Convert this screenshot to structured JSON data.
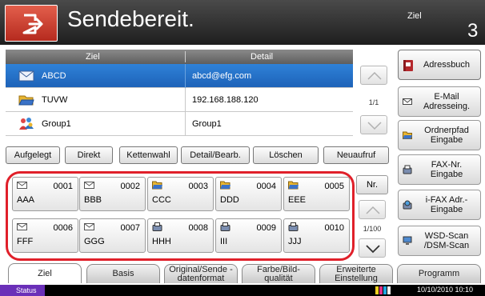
{
  "header": {
    "title": "Sendebereit.",
    "ziel_label": "Ziel",
    "ziel_count": "3",
    "send_icon": "send-to-icon"
  },
  "dest_table": {
    "col_ziel": "Ziel",
    "col_detail": "Detail",
    "rows": [
      {
        "name": "ABCD",
        "detail": "abcd@efg.com",
        "icon": "email-icon",
        "selected": true
      },
      {
        "name": "TUVW",
        "detail": "192.168.188.120",
        "icon": "folder-icon",
        "selected": false
      },
      {
        "name": "Group1",
        "detail": "Group1",
        "icon": "group-icon",
        "selected": false
      }
    ],
    "page": "1/1"
  },
  "side_buttons": {
    "adressbuch": "Adressbuch",
    "email": "E-Mail Adresseing.",
    "ordner": "Ordnerpfad Eingabe",
    "fax": "FAX-Nr. Eingabe",
    "ifax": "i-FAX Adr.-Eingabe",
    "wsd": "WSD-Scan /DSM-Scan"
  },
  "tools": {
    "aufgelegt": "Aufgelegt",
    "direkt": "Direkt",
    "kettenwahl": "Kettenwahl",
    "detail": "Detail/Bearb.",
    "loeschen": "Löschen",
    "neuaufruf": "Neuaufruf"
  },
  "one_touch": {
    "nr_label": "Nr.",
    "page": "1/100",
    "keys": [
      {
        "num": "0001",
        "name": "AAA",
        "icon": "email-icon"
      },
      {
        "num": "0002",
        "name": "BBB",
        "icon": "email-icon"
      },
      {
        "num": "0003",
        "name": "CCC",
        "icon": "folder-icon"
      },
      {
        "num": "0004",
        "name": "DDD",
        "icon": "folder-icon"
      },
      {
        "num": "0005",
        "name": "EEE",
        "icon": "folder-icon"
      },
      {
        "num": "0006",
        "name": "FFF",
        "icon": "email-icon"
      },
      {
        "num": "0007",
        "name": "GGG",
        "icon": "email-icon"
      },
      {
        "num": "0008",
        "name": "HHH",
        "icon": "fax-icon"
      },
      {
        "num": "0009",
        "name": "III",
        "icon": "fax-icon"
      },
      {
        "num": "0010",
        "name": "JJJ",
        "icon": "fax-icon"
      }
    ]
  },
  "tabs": {
    "ziel": "Ziel",
    "basis": "Basis",
    "original": "Original/Sende -datenformat",
    "farbe": "Farbe/Bild- qualität",
    "erweiterte": "Erweiterte Einstellung",
    "programm": "Programm"
  },
  "status": {
    "label": "Status",
    "datetime": "10/10/2010  10:10"
  },
  "colors": {
    "header_bg": "#2b2b2b",
    "send_tile": "#c93a2c",
    "selected_row": "#2371c8",
    "one_touch_outline": "#e0202a",
    "status_button": "#6a2fb8"
  }
}
